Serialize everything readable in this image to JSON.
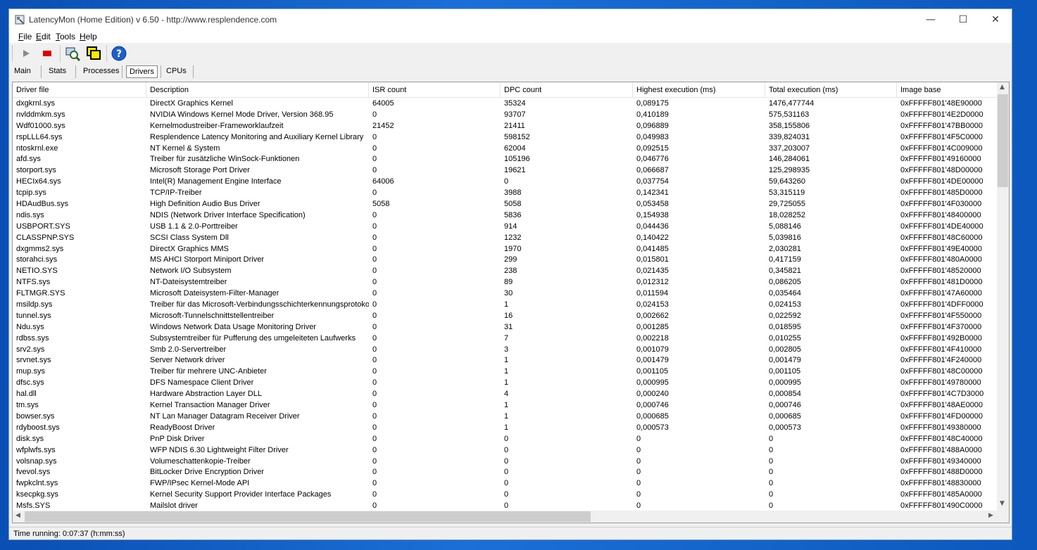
{
  "window": {
    "title": "LatencyMon  (Home Edition)  v 6.50 - http://www.resplendence.com",
    "minimize": "—",
    "maximize": "☐",
    "close": "✕"
  },
  "menu": [
    "File",
    "Edit",
    "Tools",
    "Help"
  ],
  "toolbar": {
    "icons": [
      "play-icon",
      "stop-icon",
      "analyze-icon",
      "window-icon",
      "help-icon"
    ],
    "stop_color": "#e00000",
    "help_color": "#1e5fd0"
  },
  "tabs": [
    {
      "label": "Main",
      "active": false
    },
    {
      "label": "Stats",
      "active": false
    },
    {
      "label": "Processes",
      "active": false
    },
    {
      "label": "Drivers",
      "active": true
    },
    {
      "label": "CPUs",
      "active": false
    }
  ],
  "table": {
    "columns": [
      "Driver file",
      "Description",
      "ISR count",
      "DPC count",
      "Highest execution (ms)",
      "Total execution (ms)",
      "Image base"
    ],
    "rows": [
      [
        "dxgkrnl.sys",
        "DirectX Graphics Kernel",
        "64005",
        "35324",
        "0,089175",
        "1476,477744",
        "0xFFFFF801'48E90000"
      ],
      [
        "nvlddmkm.sys",
        "NVIDIA Windows Kernel Mode Driver, Version 368.95",
        "0",
        "93707",
        "0,410189",
        "575,531163",
        "0xFFFFF801'4E2D0000"
      ],
      [
        "Wdf01000.sys",
        "Kernelmodustreiber-Frameworklaufzeit",
        "21452",
        "21411",
        "0,096889",
        "358,155806",
        "0xFFFFF801'47BB0000"
      ],
      [
        "rspLLL64.sys",
        "Resplendence Latency Monitoring and Auxiliary Kernel Library",
        "0",
        "598152",
        "0,049983",
        "339,824031",
        "0xFFFFF801'4F5C0000"
      ],
      [
        "ntoskrnl.exe",
        "NT Kernel & System",
        "0",
        "62004",
        "0,092515",
        "337,203007",
        "0xFFFFF801'4C009000"
      ],
      [
        "afd.sys",
        "Treiber für zusätzliche WinSock-Funktionen",
        "0",
        "105196",
        "0,046776",
        "146,284061",
        "0xFFFFF801'49160000"
      ],
      [
        "storport.sys",
        "Microsoft Storage Port Driver",
        "0",
        "19621",
        "0,066687",
        "125,298935",
        "0xFFFFF801'48D00000"
      ],
      [
        "HECIx64.sys",
        "Intel(R) Management Engine Interface",
        "64006",
        "0",
        "0,037754",
        "59,643260",
        "0xFFFFF801'4DE00000"
      ],
      [
        "tcpip.sys",
        "TCP/IP-Treiber",
        "0",
        "3988",
        "0,142341",
        "53,315119",
        "0xFFFFF801'485D0000"
      ],
      [
        "HDAudBus.sys",
        "High Definition Audio Bus Driver",
        "5058",
        "5058",
        "0,053458",
        "29,725055",
        "0xFFFFF801'4F030000"
      ],
      [
        "ndis.sys",
        "NDIS (Network Driver Interface Specification)",
        "0",
        "5836",
        "0,154938",
        "18,028252",
        "0xFFFFF801'48400000"
      ],
      [
        "USBPORT.SYS",
        "USB 1.1 & 2.0-Porttreiber",
        "0",
        "914",
        "0,044436",
        "5,088146",
        "0xFFFFF801'4DE40000"
      ],
      [
        "CLASSPNP.SYS",
        "SCSI Class System Dll",
        "0",
        "1232",
        "0,140422",
        "5,039816",
        "0xFFFFF801'48C60000"
      ],
      [
        "dxgmms2.sys",
        "DirectX Graphics MMS",
        "0",
        "1970",
        "0,041485",
        "2,030281",
        "0xFFFFF801'49E40000"
      ],
      [
        "storahci.sys",
        "MS AHCI Storport Miniport Driver",
        "0",
        "299",
        "0,015801",
        "0,417159",
        "0xFFFFF801'480A0000"
      ],
      [
        "NETIO.SYS",
        "Network I/O Subsystem",
        "0",
        "238",
        "0,021435",
        "0,345821",
        "0xFFFFF801'48520000"
      ],
      [
        "NTFS.sys",
        "NT-Dateisystemtreiber",
        "0",
        "89",
        "0,012312",
        "0,086205",
        "0xFFFFF801'481D0000"
      ],
      [
        "FLTMGR.SYS",
        "Microsoft Dateisystem-Filter-Manager",
        "0",
        "30",
        "0,011594",
        "0,035464",
        "0xFFFFF801'47A60000"
      ],
      [
        "msildp.sys",
        "Treiber für das Microsoft-Verbindungsschichterkennungsprotokoll",
        "0",
        "1",
        "0,024153",
        "0,024153",
        "0xFFFFF801'4DFF0000"
      ],
      [
        "tunnel.sys",
        "Microsoft-Tunnelschnittstellentreiber",
        "0",
        "16",
        "0,002662",
        "0,022592",
        "0xFFFFF801'4F550000"
      ],
      [
        "Ndu.sys",
        "Windows Network Data Usage Monitoring Driver",
        "0",
        "31",
        "0,001285",
        "0,018595",
        "0xFFFFF801'4F370000"
      ],
      [
        "rdbss.sys",
        "Subsystemtreiber für Pufferung des umgeleiteten Laufwerks",
        "0",
        "7",
        "0,002218",
        "0,010255",
        "0xFFFFF801'492B0000"
      ],
      [
        "srv2.sys",
        "Smb 2.0-Servertreiber",
        "0",
        "3",
        "0,001079",
        "0,002805",
        "0xFFFFF801'4F410000"
      ],
      [
        "srvnet.sys",
        "Server Network driver",
        "0",
        "1",
        "0,001479",
        "0,001479",
        "0xFFFFF801'4F240000"
      ],
      [
        "mup.sys",
        "Treiber für mehrere UNC-Anbieter",
        "0",
        "1",
        "0,001105",
        "0,001105",
        "0xFFFFF801'48C00000"
      ],
      [
        "dfsc.sys",
        "DFS Namespace Client Driver",
        "0",
        "1",
        "0,000995",
        "0,000995",
        "0xFFFFF801'49780000"
      ],
      [
        "hal.dll",
        "Hardware Abstraction Layer DLL",
        "0",
        "4",
        "0,000240",
        "0,000854",
        "0xFFFFF801'4C7D3000"
      ],
      [
        "tm.sys",
        "Kernel Transaction Manager Driver",
        "0",
        "1",
        "0,000746",
        "0,000746",
        "0xFFFFF801'48AE0000"
      ],
      [
        "bowser.sys",
        "NT Lan Manager Datagram Receiver Driver",
        "0",
        "1",
        "0,000685",
        "0,000685",
        "0xFFFFF801'4FD00000"
      ],
      [
        "rdyboost.sys",
        "ReadyBoost Driver",
        "0",
        "1",
        "0,000573",
        "0,000573",
        "0xFFFFF801'49380000"
      ],
      [
        "disk.sys",
        "PnP Disk Driver",
        "0",
        "0",
        "0",
        "0",
        "0xFFFFF801'48C40000"
      ],
      [
        "wfplwfs.sys",
        "WFP NDIS 6.30 Lightweight Filter Driver",
        "0",
        "0",
        "0",
        "0",
        "0xFFFFF801'488A0000"
      ],
      [
        "volsnap.sys",
        "Volumeschattenkopie-Treiber",
        "0",
        "0",
        "0",
        "0",
        "0xFFFFF801'49340000"
      ],
      [
        "fvevol.sys",
        "BitLocker Drive Encryption Driver",
        "0",
        "0",
        "0",
        "0",
        "0xFFFFF801'488D0000"
      ],
      [
        "fwpkclnt.sys",
        "FWP/IPsec Kernel-Mode API",
        "0",
        "0",
        "0",
        "0",
        "0xFFFFF801'48830000"
      ],
      [
        "ksecpkg.sys",
        "Kernel Security Support Provider Interface Packages",
        "0",
        "0",
        "0",
        "0",
        "0xFFFFF801'485A0000"
      ],
      [
        "Msfs.SYS",
        "Mailslot driver",
        "0",
        "0",
        "0",
        "0",
        "0xFFFFF801'490C0000"
      ]
    ]
  },
  "status": {
    "text": "Time running: 0:07:37  (h:mm:ss)"
  }
}
